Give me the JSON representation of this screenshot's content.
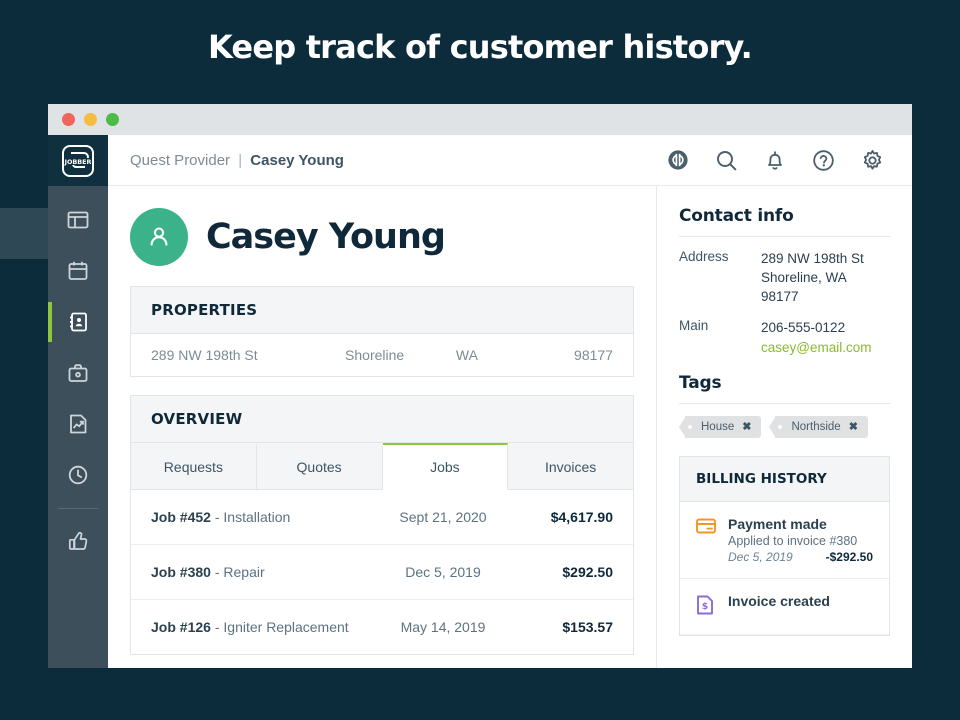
{
  "promo": {
    "headline": "Keep track of customer history."
  },
  "colors": {
    "page_background": "#0c2b3b",
    "accent_green": "#8ec63f",
    "avatar_green": "#3cb28b",
    "email_link": "#8ab92d",
    "rail_background": "#3d4f5a",
    "logo_background": "#11303f",
    "payment_icon": "#f0972b",
    "invoice_icon": "#8b6bd4"
  },
  "window": {
    "traffic_lights": [
      "close-red",
      "minimize-yellow",
      "maximize-green"
    ]
  },
  "rail": {
    "logo_label": "JOBBER",
    "items": [
      {
        "name": "dashboard",
        "icon": "dashboard-icon",
        "active": false
      },
      {
        "name": "schedule",
        "icon": "calendar-icon",
        "active": false
      },
      {
        "name": "clients",
        "icon": "contacts-book-icon",
        "active": true
      },
      {
        "name": "jobs",
        "icon": "toolbox-icon",
        "active": false
      },
      {
        "name": "reports",
        "icon": "report-chart-icon",
        "active": false
      },
      {
        "name": "timesheets",
        "icon": "clock-icon",
        "active": false
      },
      {
        "name": "feedback",
        "icon": "thumbs-up-icon",
        "active": false
      }
    ]
  },
  "topbar": {
    "breadcrumb": {
      "company": "Quest Provider",
      "separator": "|",
      "current": "Casey Young"
    },
    "icons": [
      "quickbooks-icon",
      "search-icon",
      "bell-icon",
      "help-icon",
      "gear-icon"
    ]
  },
  "profile": {
    "name": "Casey Young",
    "avatar_icon": "person-icon"
  },
  "properties": {
    "title": "PROPERTIES",
    "rows": [
      {
        "street": "289 NW 198th St",
        "city": "Shoreline",
        "state": "WA",
        "zip": "98177"
      }
    ]
  },
  "overview": {
    "title": "OVERVIEW",
    "tabs": [
      {
        "label": "Requests",
        "active": false
      },
      {
        "label": "Quotes",
        "active": false
      },
      {
        "label": "Jobs",
        "active": true
      },
      {
        "label": "Invoices",
        "active": false
      }
    ],
    "jobs": [
      {
        "id": "Job #452",
        "dash": " - ",
        "desc": "Installation",
        "date": "Sept 21, 2020",
        "amount": "$4,617.90"
      },
      {
        "id": "Job #380",
        "dash": " - ",
        "desc": "Repair",
        "date": "Dec 5, 2019",
        "amount": "$292.50"
      },
      {
        "id": "Job #126",
        "dash": " - ",
        "desc": "Igniter Replacement",
        "date": "May 14, 2019",
        "amount": "$153.57"
      }
    ]
  },
  "contact_info": {
    "title": "Contact info",
    "address_label": "Address",
    "address_line1": "289 NW 198th St",
    "address_line2": "Shoreline, WA",
    "address_line3": "98177",
    "main_label": "Main",
    "phone": "206-555-0122",
    "email": "casey@email.com"
  },
  "tags": {
    "title": "Tags",
    "items": [
      {
        "label": "House",
        "remove": "✖"
      },
      {
        "label": "Northside",
        "remove": "✖"
      }
    ]
  },
  "billing_history": {
    "title": "BILLING HISTORY",
    "items": [
      {
        "icon": "credit-card-icon",
        "title": "Payment made",
        "subtitle": "Applied to invoice #380",
        "date": "Dec 5, 2019",
        "amount": "-$292.50"
      },
      {
        "icon": "invoice-dollar-icon",
        "title": "Invoice created",
        "subtitle": "",
        "date": "",
        "amount": ""
      }
    ]
  }
}
